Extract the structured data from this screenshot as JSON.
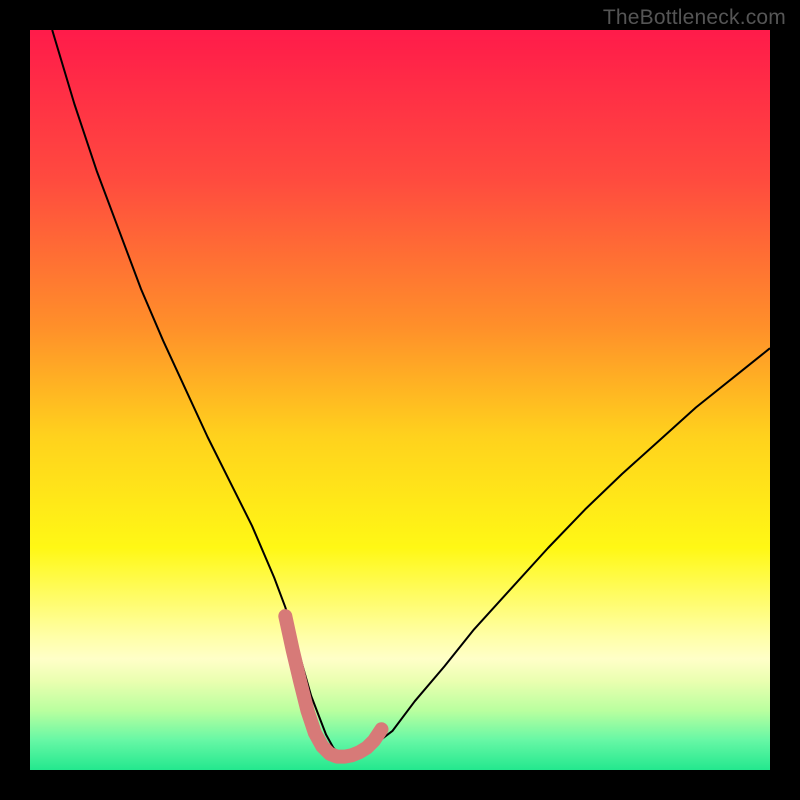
{
  "watermark": "TheBottleneck.com",
  "chart_data": {
    "type": "line",
    "title": "",
    "xlabel": "",
    "ylabel": "",
    "xlim": [
      0,
      100
    ],
    "ylim": [
      0,
      100
    ],
    "grid": false,
    "annotations": [],
    "background": {
      "kind": "vertical-gradient",
      "stops": [
        {
          "t": 0.0,
          "color": "#ff1b4a"
        },
        {
          "t": 0.2,
          "color": "#ff4a3f"
        },
        {
          "t": 0.4,
          "color": "#ff8f2a"
        },
        {
          "t": 0.55,
          "color": "#ffd21d"
        },
        {
          "t": 0.7,
          "color": "#fff815"
        },
        {
          "t": 0.82,
          "color": "#ffffa8"
        },
        {
          "t": 0.85,
          "color": "#ffffc8"
        },
        {
          "t": 0.88,
          "color": "#eaffb0"
        },
        {
          "t": 0.92,
          "color": "#b9ff9f"
        },
        {
          "t": 0.96,
          "color": "#66f7a5"
        },
        {
          "t": 1.0,
          "color": "#23e88e"
        }
      ]
    },
    "series": [
      {
        "name": "bottleneck-curve",
        "color": "#000000",
        "stroke_width": 2,
        "x": [
          3,
          6,
          9,
          12,
          15,
          18,
          21,
          24,
          27,
          30,
          33,
          34.5,
          36,
          38,
          40,
          41,
          42,
          44,
          46,
          49,
          52,
          56,
          60,
          65,
          70,
          75,
          80,
          85,
          90,
          95,
          100
        ],
        "values": [
          100,
          90,
          81,
          73,
          65,
          58,
          51.5,
          45,
          39,
          33,
          26,
          22,
          17,
          10,
          4.8,
          3.0,
          2.0,
          2.0,
          3.0,
          5.3,
          9.3,
          14,
          19,
          24.5,
          30,
          35.2,
          40,
          44.5,
          49,
          53,
          57
        ]
      },
      {
        "name": "optimal-flat",
        "color": "#d77a78",
        "stroke_width": 14,
        "linecap": "round",
        "x": [
          34.5,
          35.5,
          36.5,
          37.5,
          38.5,
          39.5,
          40.5,
          41.5,
          42.5,
          43.5,
          44.5,
          45.5,
          46.5,
          47.5
        ],
        "values": [
          20.8,
          16.2,
          12.0,
          8.0,
          5.0,
          3.2,
          2.2,
          1.8,
          1.8,
          2.0,
          2.4,
          3.0,
          4.0,
          5.5
        ]
      }
    ]
  }
}
